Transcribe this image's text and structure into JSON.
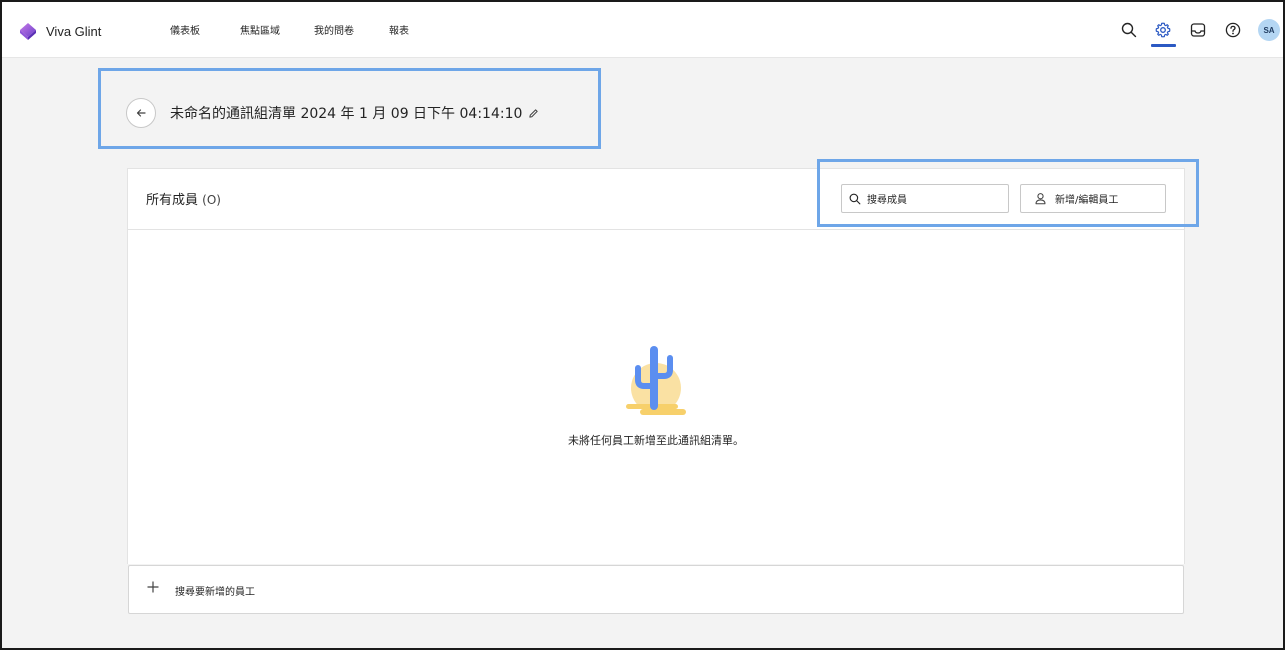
{
  "app": {
    "name": "Viva Glint"
  },
  "nav": {
    "items": [
      {
        "label": "儀表板"
      },
      {
        "label": "焦點區域"
      },
      {
        "label": "我的問卷"
      },
      {
        "label": "報表"
      }
    ]
  },
  "topbar": {
    "icons": [
      "search-icon",
      "gear-icon",
      "inbox-icon",
      "help-icon"
    ],
    "active_icon": "gear-icon",
    "avatar_initials": "SA"
  },
  "page": {
    "title": "未命名的通訊組清單 2024 年 1 月 09 日下午 04:14:10"
  },
  "members": {
    "title": "所有成員",
    "count": "(O)",
    "search_placeholder": "搜尋成員",
    "add_button_label": "新增/編輯員工",
    "empty_message": "未將任何員工新增至此通訊組清單。"
  },
  "add_bar": {
    "label": "搜尋要新增的員工"
  },
  "colors": {
    "accent": "#2b59c3",
    "highlight": "#6ea6e8",
    "cactus": "#5b8ef0",
    "sun": "#f9dc93"
  }
}
